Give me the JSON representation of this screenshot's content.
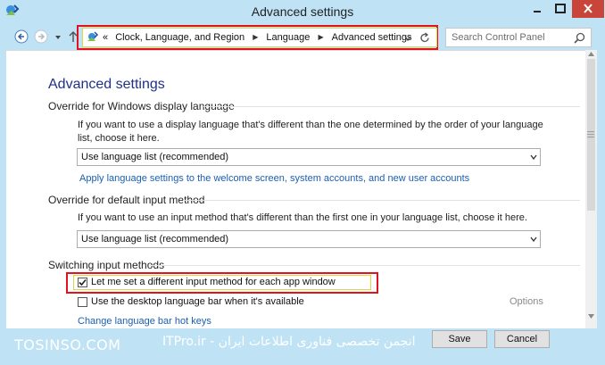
{
  "window": {
    "title": "Advanced settings"
  },
  "address_bar": {
    "overflow": "«",
    "crumbs": [
      "Clock, Language, and Region",
      "Language",
      "Advanced settings"
    ]
  },
  "search": {
    "placeholder": "Search Control Panel"
  },
  "content": {
    "page_title": "Advanced settings",
    "sections": [
      {
        "title": "Override for Windows display language",
        "description": "If you want to use a display language that's different than the one determined by the order of your language list, choose it here.",
        "select_value": "Use language list (recommended)",
        "link": "Apply language settings to the welcome screen, system accounts, and new user accounts"
      },
      {
        "title": "Override for default input method",
        "description": "If you want to use an input method that's different than the first one in your language list, choose it here.",
        "select_value": "Use language list (recommended)"
      },
      {
        "title": "Switching input methods",
        "checkboxes": [
          {
            "label": "Let me set a different input method for each app window",
            "checked": true
          },
          {
            "label": "Use the desktop language bar when it's available",
            "checked": false
          }
        ],
        "options_link": "Options",
        "hotkeys_link": "Change language bar hot keys"
      }
    ]
  },
  "footer": {
    "save_label": "Save",
    "cancel_label": "Cancel",
    "watermark_left": "TOSINSO.COM",
    "watermark_right": "ITPro.ir - انجمن تخصصی فناوری اطلاعات ایران"
  },
  "colors": {
    "highlight_red": "#e0141e",
    "highlight_yellow": "#e0d640",
    "page_title": "#1e3287",
    "link": "#1a5fb4",
    "window_frame": "#bfe3f5"
  }
}
